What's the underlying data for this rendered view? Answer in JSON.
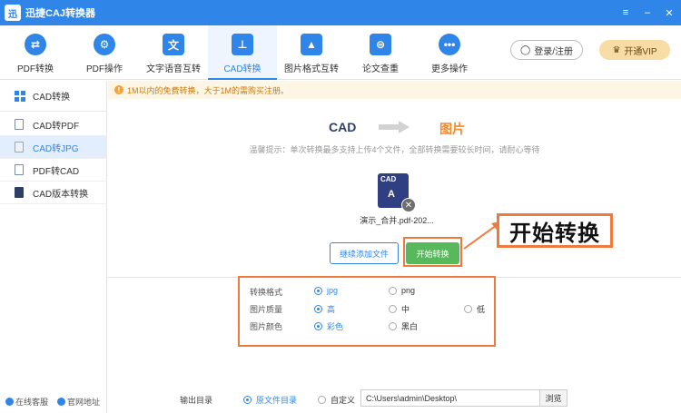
{
  "window": {
    "title": "迅捷CAJ转换器",
    "logo_glyph": "迅",
    "controls": [
      "≡",
      "–",
      "✕"
    ]
  },
  "toolbar": {
    "items": [
      {
        "label": "PDF转换",
        "icon": "pdf-convert-icon",
        "glyph": "⇄"
      },
      {
        "label": "PDF操作",
        "icon": "gear-icon",
        "glyph": "⚙"
      },
      {
        "label": "文字语音互转",
        "icon": "text-voice-icon",
        "glyph": "文"
      },
      {
        "label": "CAD转换",
        "icon": "cad-icon",
        "glyph": "⊥",
        "active": true
      },
      {
        "label": "图片格式互转",
        "icon": "image-icon",
        "glyph": "▲"
      },
      {
        "label": "论文查重",
        "icon": "paper-check-icon",
        "glyph": "⊜"
      },
      {
        "label": "更多操作",
        "icon": "more-icon",
        "glyph": "•••"
      }
    ],
    "login_label": "登录/注册",
    "vip_label": "开通VIP"
  },
  "sidebar": {
    "header": "CAD转换",
    "items": [
      {
        "label": "CAD转PDF"
      },
      {
        "label": "CAD转JPG",
        "active": true
      },
      {
        "label": "PDF转CAD"
      },
      {
        "label": "CAD版本转换"
      }
    ],
    "footer": {
      "service": "在线客服",
      "website": "官网地址"
    }
  },
  "notice": {
    "text": "1M以内的免费转换，大于1M的需购买注册。"
  },
  "main": {
    "from": "CAD",
    "to": "图片",
    "tip": "温馨提示：单次转换最多支持上传4个文件，全部转换需要较长时间，请耐心等待",
    "file": {
      "name": "演示_合并.pdf-202...",
      "badge": "CAD",
      "glyph": "A"
    },
    "add_files_label": "继续添加文件",
    "start_label": "开始转换",
    "callout": "开始转换"
  },
  "options": {
    "format": {
      "label": "转换格式",
      "choices": [
        "jpg",
        "png"
      ],
      "selected": "jpg"
    },
    "quality": {
      "label": "图片质量",
      "choices": [
        "高",
        "中",
        "低"
      ],
      "selected": "高"
    },
    "color": {
      "label": "图片颜色",
      "choices": [
        "彩色",
        "黑白"
      ],
      "selected": "彩色"
    }
  },
  "output": {
    "label": "输出目录",
    "source_dir_label": "原文件目录",
    "custom_label": "自定义",
    "path": "C:\\Users\\admin\\Desktop\\",
    "browse_label": "浏览"
  },
  "colors": {
    "accent": "#2f86e8",
    "highlight": "#ef7a3e",
    "start_green": "#57b95b",
    "to_orange": "#f28b2b"
  }
}
